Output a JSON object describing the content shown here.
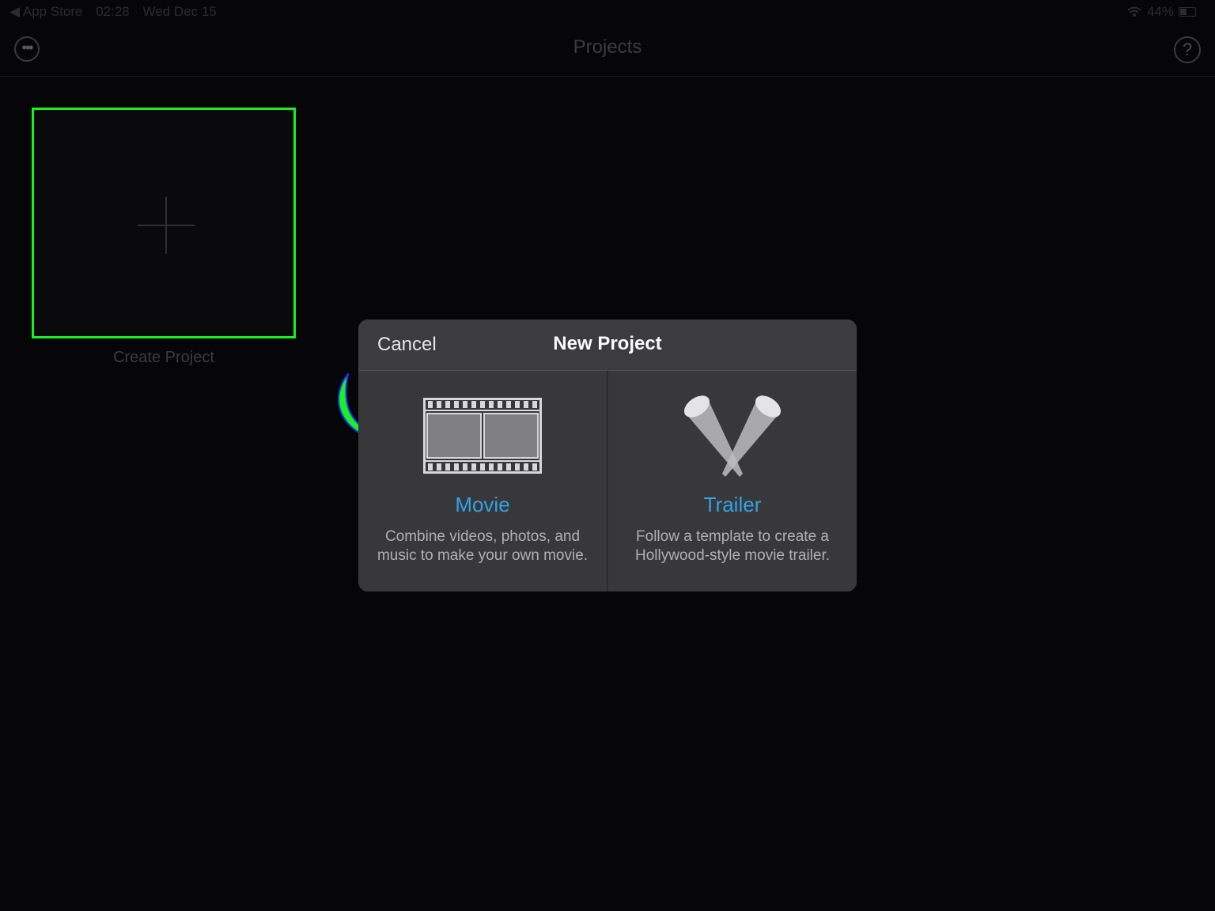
{
  "status_bar": {
    "back_label": "◀ App Store",
    "time": "02:28",
    "date": "Wed Dec 15",
    "wifi_icon": "wifi-icon",
    "battery": "44%"
  },
  "nav": {
    "more_icon": "ellipsis-circle-icon",
    "more_glyph": "•••",
    "title": "Projects",
    "help_icon": "question-circle-icon",
    "help_glyph": "?"
  },
  "create_project": {
    "icon": "plus-icon",
    "label": "Create Project",
    "highlight_color": "#19f21e"
  },
  "dialog": {
    "cancel_label": "Cancel",
    "title": "New Project",
    "options": [
      {
        "icon": "film-strip-icon",
        "title": "Movie",
        "description_line1": "Combine videos, photos, and",
        "description_line2": "music to make your own movie."
      },
      {
        "icon": "spotlights-icon",
        "title": "Trailer",
        "description_line1": "Follow a template to create a",
        "description_line2": "Hollywood-style movie trailer."
      }
    ],
    "accent_color": "#2fa3e6"
  },
  "annotation": {
    "icon": "curved-arrow-icon",
    "color": "#19f21e"
  }
}
